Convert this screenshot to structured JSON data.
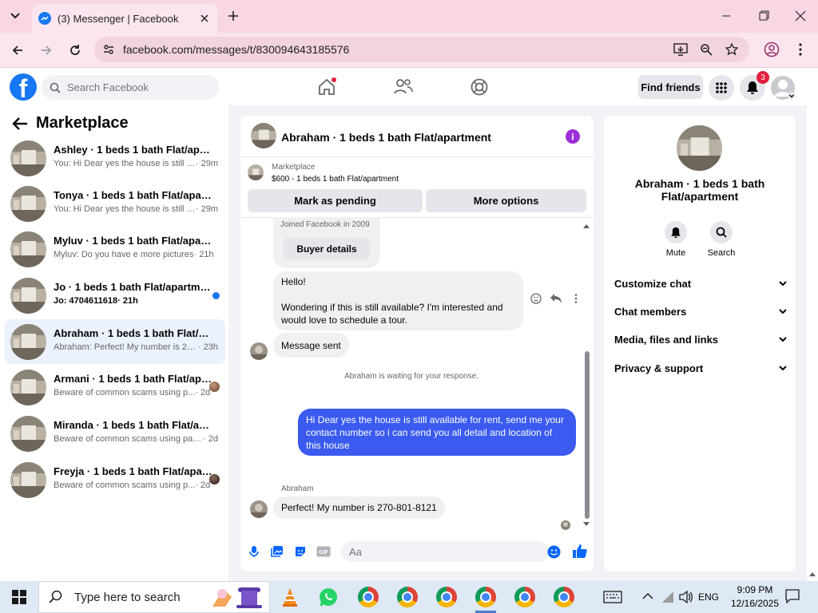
{
  "browser": {
    "tab_title": "(3) Messenger | Facebook",
    "url": "facebook.com/messages/t/830094643185576"
  },
  "fb": {
    "search_placeholder": "Search Facebook",
    "find_friends": "Find friends",
    "notification_count": "3",
    "brand_color": "#1877f2"
  },
  "sidebar": {
    "title": "Marketplace",
    "conversations": [
      {
        "name": "Ashley · 1 beds 1 bath Flat/apartm...",
        "preview": "You: Hi Dear yes the house is still av...",
        "time": " · 29m"
      },
      {
        "name": "Tonya · 1 beds 1 bath Flat/apartment",
        "preview": "You: Hi Dear yes the house is still av...",
        "time": " · 29m"
      },
      {
        "name": "Myluv · 1 beds 1 bath Flat/apartment",
        "preview": "Myluv: Do you have e more pictures",
        "time": " · 21h"
      },
      {
        "name": "Jo · 1 beds 1 bath Flat/apartment",
        "preview": "Jo: 4704611618",
        "time": " · 21h"
      },
      {
        "name": "Abraham · 1 beds 1 bath Flat/apart...",
        "preview": "Abraham: Perfect! My number is 270...",
        "time": " · 23h"
      },
      {
        "name": "Armani · 1 beds 1 bath Flat/apar...",
        "preview": "Beware of common scams using p...",
        "time": " · 2d"
      },
      {
        "name": "Miranda · 1 beds 1 bath Flat/apart...",
        "preview": "Beware of common scams using pay...",
        "time": " · 2d"
      },
      {
        "name": "Freyja · 1 beds 1 bath Flat/apart...",
        "preview": "Beware of common scams using p...",
        "time": " · 2d"
      }
    ]
  },
  "chat": {
    "title": "Abraham · 1 beds 1 bath Flat/apartment",
    "marketplace_label": "Marketplace",
    "listing": "$600 - 1 beds 1 bath Flat/apartment",
    "mark_pending": "Mark as pending",
    "more_options": "More options",
    "joined": "Joined Facebook in 2009",
    "buyer_details": "Buyer details",
    "msg1": "Hello!\n\nWondering if this is still available? I'm interested and would love to schedule a tour.",
    "msg2": "Message sent",
    "waiting": "Abraham is waiting for your response.",
    "msg_out": "Hi Dear yes the house is still available for rent, send me your contact number so i can send you all detail and location of this house",
    "sender": "Abraham",
    "msg3": "Perfect! My number is 270-801-8121",
    "composer_placeholder": "Aa",
    "accent": "#3a5af0"
  },
  "details": {
    "name": "Abraham · 1 beds 1 bath Flat/apartment",
    "mute": "Mute",
    "search": "Search",
    "sections": [
      "Customize chat",
      "Chat members",
      "Media, files and links",
      "Privacy & support"
    ]
  },
  "taskbar": {
    "search_placeholder": "Type here to search",
    "lang": "ENG",
    "time": "9:09 PM",
    "date": "12/16/2025"
  }
}
